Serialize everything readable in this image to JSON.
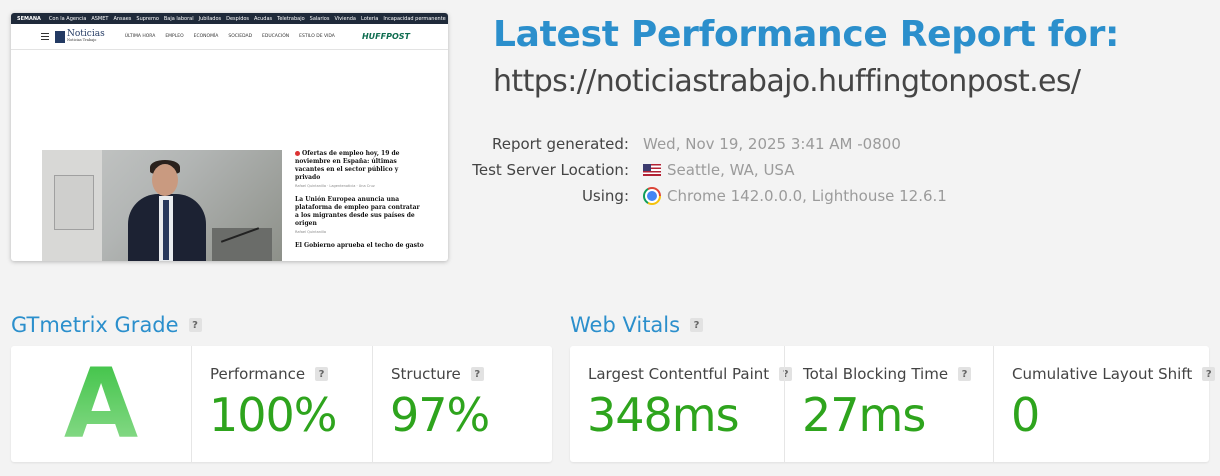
{
  "thumbnail": {
    "topbar_items": [
      "SEMANA",
      "Con la Agencia",
      "ASMET",
      "Ansaes",
      "Supremo",
      "Baja laboral",
      "Jubilados",
      "Despidos",
      "Acudas",
      "Teletrabajo",
      "Salarios",
      "Vivienda",
      "Loteria",
      "Incapacidad permanente"
    ],
    "site_logo": "Noticias",
    "site_logo_sub": "Noticias Trabajo",
    "menu_items": [
      "ÚLTIMA HORA",
      "EMPLEO",
      "ECONOMÍA",
      "SOCIEDAD",
      "EDUCACIÓN",
      "ESTILO DE VIDA"
    ],
    "partner_logo": "HUFFPOST",
    "articles": [
      {
        "headline": "Ofertas de empleo hoy, 19 de noviembre en España: últimas vacantes en el sector público y privado",
        "meta": "Rafael Quintanilla · Lagentenoticia · Una Cruz"
      },
      {
        "headline": "La Unión Europea anuncia una plataforma de empleo para contratar a los migrantes desde sus países de origen",
        "meta": "Rafael Quintanilla"
      },
      {
        "headline": "El Gobierno aprueba el techo de gasto",
        "meta": ""
      }
    ]
  },
  "report": {
    "title": "Latest Performance Report for:",
    "url": "https://noticiastrabajo.huffingtonpost.es/",
    "generated_label": "Report generated:",
    "generated_value": "Wed, Nov 19, 2025 3:41 AM -0800",
    "location_label": "Test Server Location:",
    "location_value": "Seattle, WA, USA",
    "using_label": "Using:",
    "using_value": "Chrome 142.0.0.0, Lighthouse 12.6.1"
  },
  "gtmetrix": {
    "title": "GTmetrix Grade",
    "help": "?",
    "grade": "A",
    "performance_label": "Performance",
    "performance_value": "100%",
    "structure_label": "Structure",
    "structure_value": "97%"
  },
  "vitals": {
    "title": "Web Vitals",
    "help": "?",
    "lcp_label": "Largest Contentful Paint",
    "lcp_value": "348ms",
    "tbt_label": "Total Blocking Time",
    "tbt_value": "27ms",
    "cls_label": "Cumulative Layout Shift",
    "cls_value": "0"
  },
  "colors": {
    "accent": "#2b8fcc",
    "good": "#2ea41d",
    "grade": "#46c04a"
  }
}
